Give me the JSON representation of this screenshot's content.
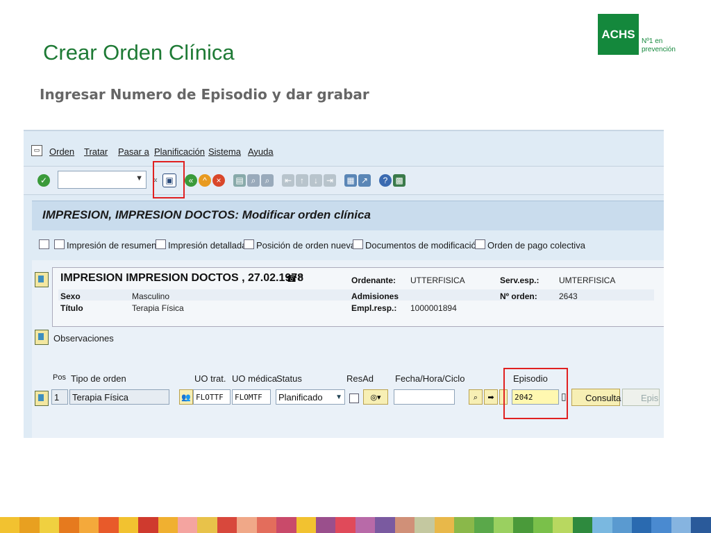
{
  "slide": {
    "title": "Crear Orden Clínica",
    "subtitle": "Ingresar Numero de Episodio y dar grabar",
    "logo": {
      "brand": "ACHS",
      "tagline_line1": "Nº1 en",
      "tagline_line2": "prevención",
      "color": "#14883c"
    }
  },
  "sap": {
    "menu": [
      "Orden",
      "Tratar",
      "Pasar a",
      "Planificación",
      "Sistema",
      "Ayuda"
    ],
    "toolbar_icons": [
      "enter-icon",
      "save-icon",
      "back-icon",
      "exit-icon",
      "cancel-icon",
      "print-icon",
      "find-icon",
      "find-next-icon",
      "first-page-icon",
      "prev-page-icon",
      "next-page-icon",
      "last-page-icon",
      "new-session-icon",
      "shortcut-icon",
      "help-icon",
      "layout-icon"
    ],
    "command_field_value": "",
    "title": "IMPRESION, IMPRESION DOCTOS: Modificar orden clínica",
    "app_toolbar": [
      "Impresión de resumen",
      "Impresión detallada",
      "Posición de orden nueva",
      "Documentos de modificación",
      "Orden de pago colectiva"
    ],
    "patient": {
      "name": "IMPRESION IMPRESION DOCTOS , 27.02.1978",
      "phone_count": "0",
      "sexo_label": "Sexo",
      "sexo": "Masculino",
      "titulo_label": "Título",
      "titulo": "Terapia Física",
      "ordenante_label": "Ordenante:",
      "ordenante": "UTTERFISICA",
      "admisiones_label": "Admisiones",
      "empl_label": "Empl.resp.:",
      "empl": "1000001894",
      "serv_label": "Serv.esp.:",
      "serv": "UMTERFISICA",
      "orden_label": "Nº orden:",
      "orden": "2643"
    },
    "observaciones": "Observaciones",
    "table": {
      "headers": {
        "pos": "Pos",
        "tipo": "Tipo de orden",
        "uo_trat": "UO trat.",
        "uo_medica": "UO médica",
        "status": "Status",
        "resad": "ResAd",
        "fecha": "Fecha/Hora/Ciclo",
        "episodio": "Episodio"
      },
      "row": {
        "pos": "1",
        "tipo": "Terapia Física",
        "uo_trat": "FLOTTF",
        "uo_medica": "FLOMTF",
        "status": "Planificado",
        "fecha": "",
        "episodio": "2042"
      }
    },
    "buttons": {
      "consulta": "Consulta",
      "epis": "Epis"
    },
    "highlight_color": "#e02020"
  },
  "footer_colors": [
    "#f2c230",
    "#e8a020",
    "#f0d040",
    "#e67a1e",
    "#f4a93b",
    "#e85a2a",
    "#f2c230",
    "#cf3a2e",
    "#f0b030",
    "#f4a4a0",
    "#e8c24a",
    "#d8483c",
    "#f0a888",
    "#e36d5c",
    "#c94a6a",
    "#f2c230",
    "#9a4f8c",
    "#e04a5a",
    "#b86aa8",
    "#7a5aa0",
    "#d09078",
    "#c4c8a0",
    "#e8b84a",
    "#8ab84a",
    "#5aa84a",
    "#9ad060",
    "#4a9a3a",
    "#7ac04a",
    "#b8d860",
    "#2e8a3e",
    "#7ab8e0",
    "#5a9ad0",
    "#2a6ab0",
    "#4a8ad0",
    "#86b4e0",
    "#2a5a9a"
  ]
}
